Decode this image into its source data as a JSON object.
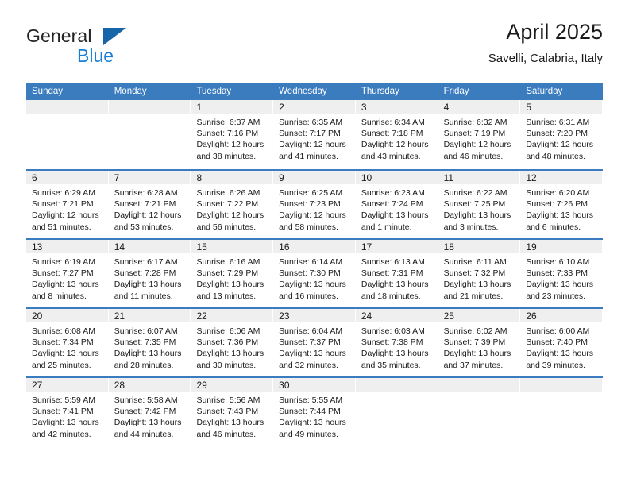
{
  "brand": {
    "name_part1": "General",
    "name_part2": "Blue",
    "logo_icon": "triangle-logo-icon",
    "accent_color": "#1a7fd4",
    "triangle_color": "#1565a8"
  },
  "header": {
    "title": "April 2025",
    "subtitle": "Savelli, Calabria, Italy"
  },
  "calendar": {
    "header_bg": "#3b7cbf",
    "daynum_bg": "#efefef",
    "weekdays": [
      "Sunday",
      "Monday",
      "Tuesday",
      "Wednesday",
      "Thursday",
      "Friday",
      "Saturday"
    ],
    "weeks": [
      [
        {
          "day": "",
          "lines": []
        },
        {
          "day": "",
          "lines": []
        },
        {
          "day": "1",
          "lines": [
            "Sunrise: 6:37 AM",
            "Sunset: 7:16 PM",
            "Daylight: 12 hours",
            "and 38 minutes."
          ]
        },
        {
          "day": "2",
          "lines": [
            "Sunrise: 6:35 AM",
            "Sunset: 7:17 PM",
            "Daylight: 12 hours",
            "and 41 minutes."
          ]
        },
        {
          "day": "3",
          "lines": [
            "Sunrise: 6:34 AM",
            "Sunset: 7:18 PM",
            "Daylight: 12 hours",
            "and 43 minutes."
          ]
        },
        {
          "day": "4",
          "lines": [
            "Sunrise: 6:32 AM",
            "Sunset: 7:19 PM",
            "Daylight: 12 hours",
            "and 46 minutes."
          ]
        },
        {
          "day": "5",
          "lines": [
            "Sunrise: 6:31 AM",
            "Sunset: 7:20 PM",
            "Daylight: 12 hours",
            "and 48 minutes."
          ]
        }
      ],
      [
        {
          "day": "6",
          "lines": [
            "Sunrise: 6:29 AM",
            "Sunset: 7:21 PM",
            "Daylight: 12 hours",
            "and 51 minutes."
          ]
        },
        {
          "day": "7",
          "lines": [
            "Sunrise: 6:28 AM",
            "Sunset: 7:21 PM",
            "Daylight: 12 hours",
            "and 53 minutes."
          ]
        },
        {
          "day": "8",
          "lines": [
            "Sunrise: 6:26 AM",
            "Sunset: 7:22 PM",
            "Daylight: 12 hours",
            "and 56 minutes."
          ]
        },
        {
          "day": "9",
          "lines": [
            "Sunrise: 6:25 AM",
            "Sunset: 7:23 PM",
            "Daylight: 12 hours",
            "and 58 minutes."
          ]
        },
        {
          "day": "10",
          "lines": [
            "Sunrise: 6:23 AM",
            "Sunset: 7:24 PM",
            "Daylight: 13 hours",
            "and 1 minute."
          ]
        },
        {
          "day": "11",
          "lines": [
            "Sunrise: 6:22 AM",
            "Sunset: 7:25 PM",
            "Daylight: 13 hours",
            "and 3 minutes."
          ]
        },
        {
          "day": "12",
          "lines": [
            "Sunrise: 6:20 AM",
            "Sunset: 7:26 PM",
            "Daylight: 13 hours",
            "and 6 minutes."
          ]
        }
      ],
      [
        {
          "day": "13",
          "lines": [
            "Sunrise: 6:19 AM",
            "Sunset: 7:27 PM",
            "Daylight: 13 hours",
            "and 8 minutes."
          ]
        },
        {
          "day": "14",
          "lines": [
            "Sunrise: 6:17 AM",
            "Sunset: 7:28 PM",
            "Daylight: 13 hours",
            "and 11 minutes."
          ]
        },
        {
          "day": "15",
          "lines": [
            "Sunrise: 6:16 AM",
            "Sunset: 7:29 PM",
            "Daylight: 13 hours",
            "and 13 minutes."
          ]
        },
        {
          "day": "16",
          "lines": [
            "Sunrise: 6:14 AM",
            "Sunset: 7:30 PM",
            "Daylight: 13 hours",
            "and 16 minutes."
          ]
        },
        {
          "day": "17",
          "lines": [
            "Sunrise: 6:13 AM",
            "Sunset: 7:31 PM",
            "Daylight: 13 hours",
            "and 18 minutes."
          ]
        },
        {
          "day": "18",
          "lines": [
            "Sunrise: 6:11 AM",
            "Sunset: 7:32 PM",
            "Daylight: 13 hours",
            "and 21 minutes."
          ]
        },
        {
          "day": "19",
          "lines": [
            "Sunrise: 6:10 AM",
            "Sunset: 7:33 PM",
            "Daylight: 13 hours",
            "and 23 minutes."
          ]
        }
      ],
      [
        {
          "day": "20",
          "lines": [
            "Sunrise: 6:08 AM",
            "Sunset: 7:34 PM",
            "Daylight: 13 hours",
            "and 25 minutes."
          ]
        },
        {
          "day": "21",
          "lines": [
            "Sunrise: 6:07 AM",
            "Sunset: 7:35 PM",
            "Daylight: 13 hours",
            "and 28 minutes."
          ]
        },
        {
          "day": "22",
          "lines": [
            "Sunrise: 6:06 AM",
            "Sunset: 7:36 PM",
            "Daylight: 13 hours",
            "and 30 minutes."
          ]
        },
        {
          "day": "23",
          "lines": [
            "Sunrise: 6:04 AM",
            "Sunset: 7:37 PM",
            "Daylight: 13 hours",
            "and 32 minutes."
          ]
        },
        {
          "day": "24",
          "lines": [
            "Sunrise: 6:03 AM",
            "Sunset: 7:38 PM",
            "Daylight: 13 hours",
            "and 35 minutes."
          ]
        },
        {
          "day": "25",
          "lines": [
            "Sunrise: 6:02 AM",
            "Sunset: 7:39 PM",
            "Daylight: 13 hours",
            "and 37 minutes."
          ]
        },
        {
          "day": "26",
          "lines": [
            "Sunrise: 6:00 AM",
            "Sunset: 7:40 PM",
            "Daylight: 13 hours",
            "and 39 minutes."
          ]
        }
      ],
      [
        {
          "day": "27",
          "lines": [
            "Sunrise: 5:59 AM",
            "Sunset: 7:41 PM",
            "Daylight: 13 hours",
            "and 42 minutes."
          ]
        },
        {
          "day": "28",
          "lines": [
            "Sunrise: 5:58 AM",
            "Sunset: 7:42 PM",
            "Daylight: 13 hours",
            "and 44 minutes."
          ]
        },
        {
          "day": "29",
          "lines": [
            "Sunrise: 5:56 AM",
            "Sunset: 7:43 PM",
            "Daylight: 13 hours",
            "and 46 minutes."
          ]
        },
        {
          "day": "30",
          "lines": [
            "Sunrise: 5:55 AM",
            "Sunset: 7:44 PM",
            "Daylight: 13 hours",
            "and 49 minutes."
          ]
        },
        {
          "day": "",
          "lines": []
        },
        {
          "day": "",
          "lines": []
        },
        {
          "day": "",
          "lines": []
        }
      ]
    ]
  }
}
